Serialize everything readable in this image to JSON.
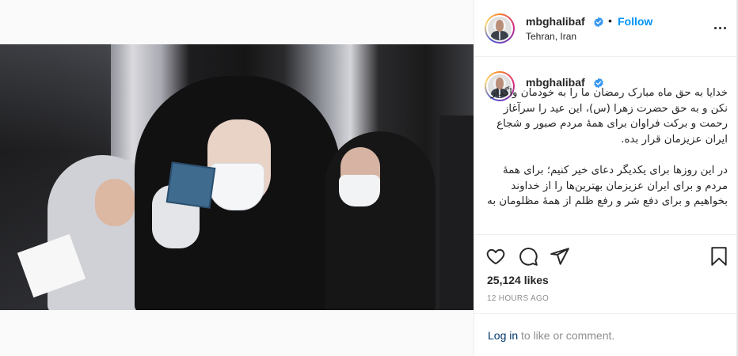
{
  "post": {
    "username": "mbghalibaf",
    "location": "Tehran, Iran",
    "follow_label": "Follow",
    "dot": "•",
    "caption": "خدایا به حق ماه مبارک رمضان ما را به خودمان واگذار نکن و به حق حضرت زهرا (س)، این عید را سرآغاز رحمت و برکت فراوان برای همهٔ مردم صبور و شجاع ایران عزیزمان قرار بده.\n\nدر این روزها برای یکدیگر دعای خیر کنیم؛ برای همهٔ مردم و برای ایران عزیزمان بهترین‌ها را از خداوند بخواهیم و برای دفع شر و رفع ظلم از همهٔ مظلومان به",
    "likes": "25,124 likes",
    "time": "12 HOURS AGO"
  },
  "comment_bar": {
    "login_label": "Log in",
    "rest_text": "to like or comment."
  },
  "icons": {
    "like": "heart-icon",
    "comment": "comment-icon",
    "share": "paper-plane-icon",
    "save": "bookmark-icon",
    "more": "more-options-icon",
    "verified": "verified-badge-icon"
  },
  "colors": {
    "follow": "#0095f6",
    "verified": "#3897f0",
    "login": "#00376b",
    "muted": "#8e8e8e"
  }
}
